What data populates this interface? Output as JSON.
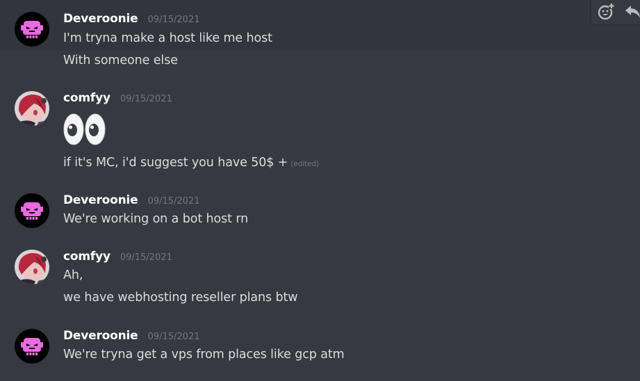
{
  "messages": [
    {
      "author": "Deveroonie",
      "timestamp": "09/15/2021",
      "lines": [
        "I'm tryna make a host like me host",
        "With someone else"
      ]
    },
    {
      "author": "comfyy",
      "timestamp": "09/15/2021",
      "emoji": "eyes",
      "lines": [
        "if it's MC, i'd suggest you have 50$ +"
      ],
      "edited_label": "(edited)"
    },
    {
      "author": "Deveroonie",
      "timestamp": "09/15/2021",
      "lines": [
        "We're working on a bot host rn"
      ]
    },
    {
      "author": "comfyy",
      "timestamp": "09/15/2021",
      "lines": [
        "Ah,",
        "we have webhosting reseller plans btw"
      ]
    },
    {
      "author": "Deveroonie",
      "timestamp": "09/15/2021",
      "lines": [
        "We're tryna get a vps from places like gcp atm"
      ]
    }
  ],
  "toolbar": {
    "add_reaction_icon": "add-reaction-icon",
    "reply_icon": "reply-icon"
  },
  "colors": {
    "background": "#36393f",
    "text": "#dcddde",
    "username": "#ffffff",
    "timestamp": "#72767d",
    "bot_face": "#e86be0"
  }
}
